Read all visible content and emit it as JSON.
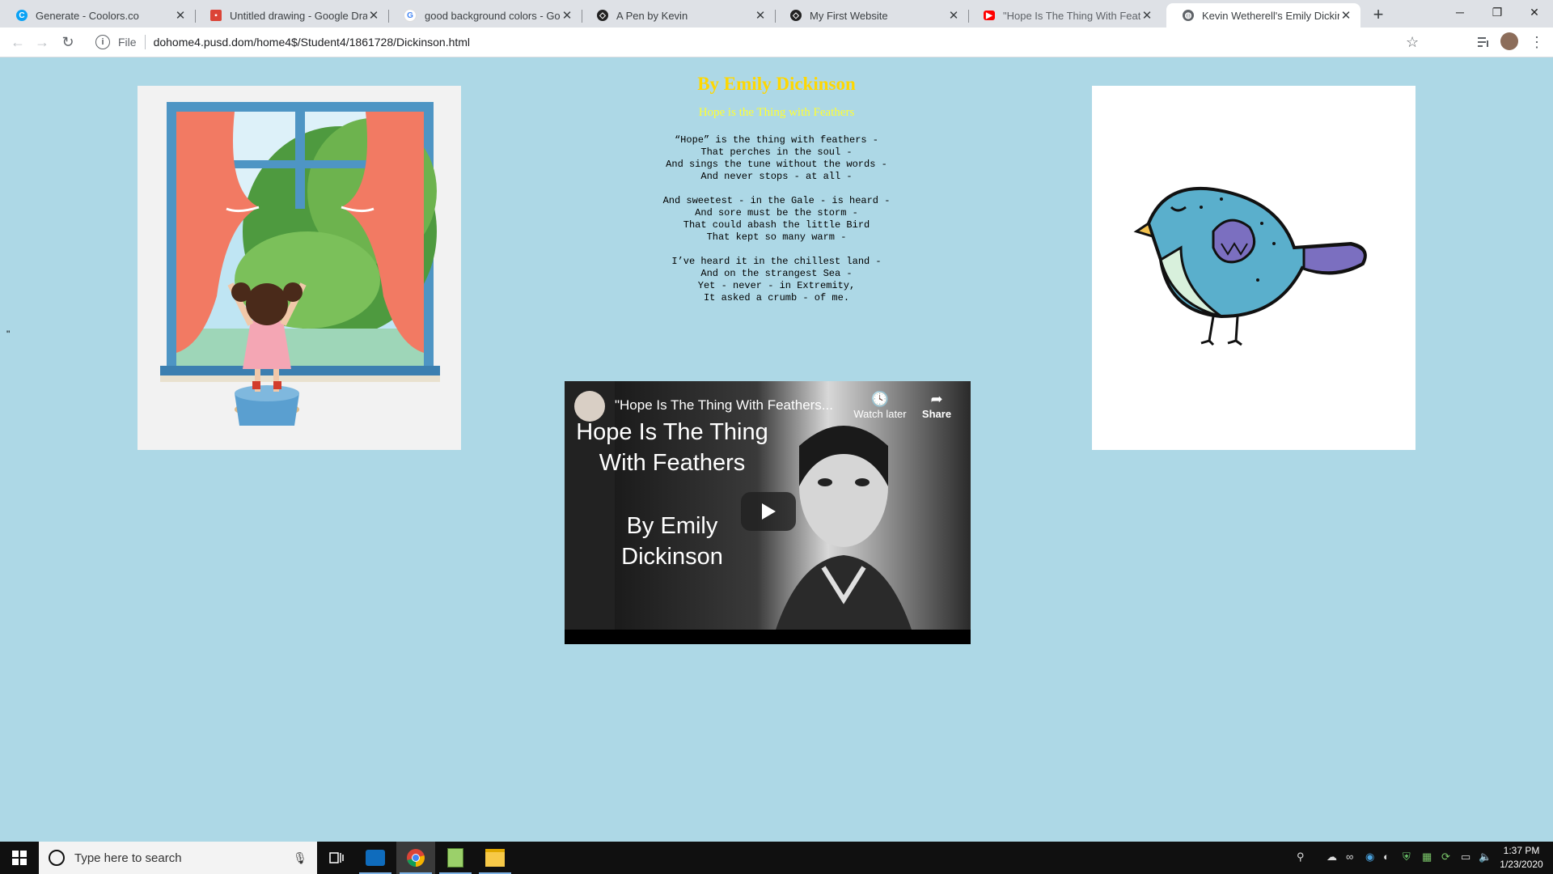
{
  "tabs": [
    {
      "label": "Generate - Coolors.co",
      "favicon": "coolors-icon",
      "color": "#0AA2F5"
    },
    {
      "label": "Untitled drawing - Google Drawi",
      "favicon": "google-drawings-icon",
      "color": "#DB4437"
    },
    {
      "label": "good background colors - Googl",
      "favicon": "google-icon",
      "color": "#4285F4"
    },
    {
      "label": "A Pen by Kevin",
      "favicon": "codepen-icon",
      "color": "#222222"
    },
    {
      "label": "My First Website",
      "favicon": "codepen-icon",
      "color": "#222222"
    },
    {
      "label": "\"Hope Is The Thing With Feather",
      "favicon": "youtube-icon",
      "color": "#FF0000"
    },
    {
      "label": "Kevin Wetherell's Emily Dickinson",
      "favicon": "globe-icon",
      "color": "#5f6368"
    }
  ],
  "window_controls": {
    "minimize": "─",
    "restore": "❐",
    "close": "✕"
  },
  "address_bar": {
    "scheme_label": "File",
    "url": "dohome4.pusd.dom/home4$/Student4/1861728/Dickinson.html"
  },
  "page": {
    "background": "#ADD8E6",
    "title": "By Emily Dickinson",
    "subtitle": "Hope is the Thing with Feathers",
    "stanzas": [
      "“Hope” is the thing with feathers -\nThat perches in the soul -\nAnd sings the tune without the words -\nAnd never stops - at all -",
      "And sweetest - in the Gale - is heard -\nAnd sore must be the storm -\nThat could abash the little Bird\nThat kept so many warm -",
      "I’ve heard it in the chillest land -\nAnd on the strangest Sea -\nYet - never - in Extremity,\nIt asked a crumb - of me."
    ],
    "stray_quote": "\""
  },
  "video": {
    "title": "\"Hope Is The Thing With Feathers...",
    "overlay_line1": "Hope Is The Thing",
    "overlay_line2": "With Feathers",
    "overlay_line3": "By Emily",
    "overlay_line4": "Dickinson",
    "watch_later": "Watch later",
    "share": "Share"
  },
  "taskbar": {
    "search_placeholder": "Type here to search",
    "time": "1:37 PM",
    "date": "1/23/2020"
  }
}
